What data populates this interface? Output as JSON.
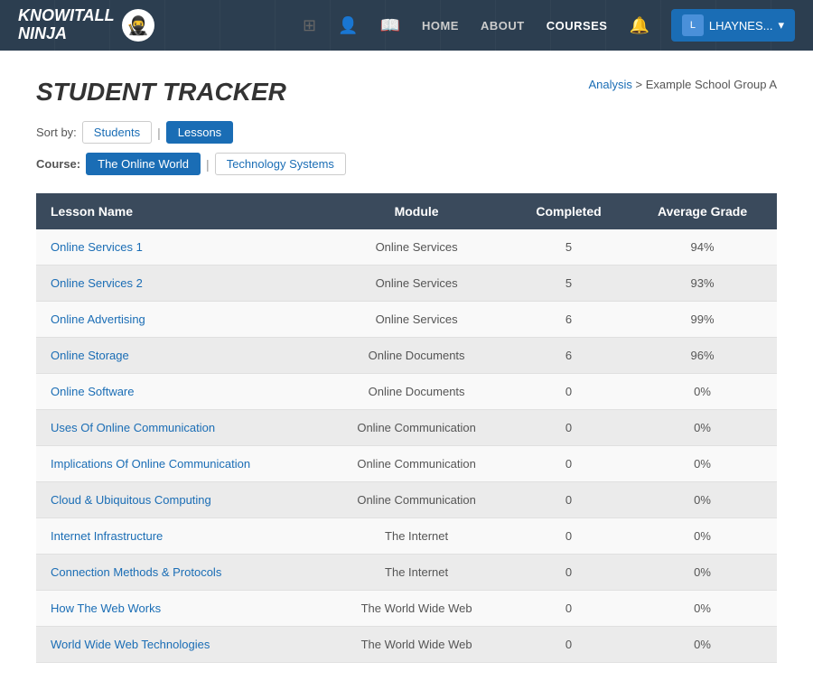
{
  "nav": {
    "logo_line1": "KNOWITALL",
    "logo_line2": "NINJA",
    "links": [
      {
        "label": "HOME",
        "active": false
      },
      {
        "label": "ABOUT",
        "active": false
      },
      {
        "label": "COURSES",
        "active": true
      }
    ],
    "user_label": "LHAYNES...",
    "user_avatar": "L"
  },
  "page": {
    "title": "STUDENT TRACKER",
    "breadcrumb_link": "Analysis",
    "breadcrumb_text": "> Example School Group A",
    "sort_label": "Sort by:",
    "sort_options": [
      {
        "label": "Students",
        "active": false
      },
      {
        "label": "Lessons",
        "active": true
      }
    ],
    "course_label": "Course:",
    "course_options": [
      {
        "label": "The Online World",
        "active": true
      },
      {
        "label": "Technology Systems",
        "active": false
      }
    ]
  },
  "table": {
    "headers": [
      "Lesson Name",
      "Module",
      "Completed",
      "Average Grade"
    ],
    "rows": [
      {
        "lesson": "Online Services 1",
        "module": "Online Services",
        "completed": 5,
        "grade": "94%"
      },
      {
        "lesson": "Online Services 2",
        "module": "Online Services",
        "completed": 5,
        "grade": "93%"
      },
      {
        "lesson": "Online Advertising",
        "module": "Online Services",
        "completed": 6,
        "grade": "99%"
      },
      {
        "lesson": "Online Storage",
        "module": "Online Documents",
        "completed": 6,
        "grade": "96%"
      },
      {
        "lesson": "Online Software",
        "module": "Online Documents",
        "completed": 0,
        "grade": "0%"
      },
      {
        "lesson": "Uses Of Online Communication",
        "module": "Online Communication",
        "completed": 0,
        "grade": "0%"
      },
      {
        "lesson": "Implications Of Online Communication",
        "module": "Online Communication",
        "completed": 0,
        "grade": "0%"
      },
      {
        "lesson": "Cloud & Ubiquitous Computing",
        "module": "Online Communication",
        "completed": 0,
        "grade": "0%"
      },
      {
        "lesson": "Internet Infrastructure",
        "module": "The Internet",
        "completed": 0,
        "grade": "0%"
      },
      {
        "lesson": "Connection Methods & Protocols",
        "module": "The Internet",
        "completed": 0,
        "grade": "0%"
      },
      {
        "lesson": "How The Web Works",
        "module": "The World Wide Web",
        "completed": 0,
        "grade": "0%"
      },
      {
        "lesson": "World Wide Web Technologies",
        "module": "The World Wide Web",
        "completed": 0,
        "grade": "0%"
      }
    ]
  }
}
